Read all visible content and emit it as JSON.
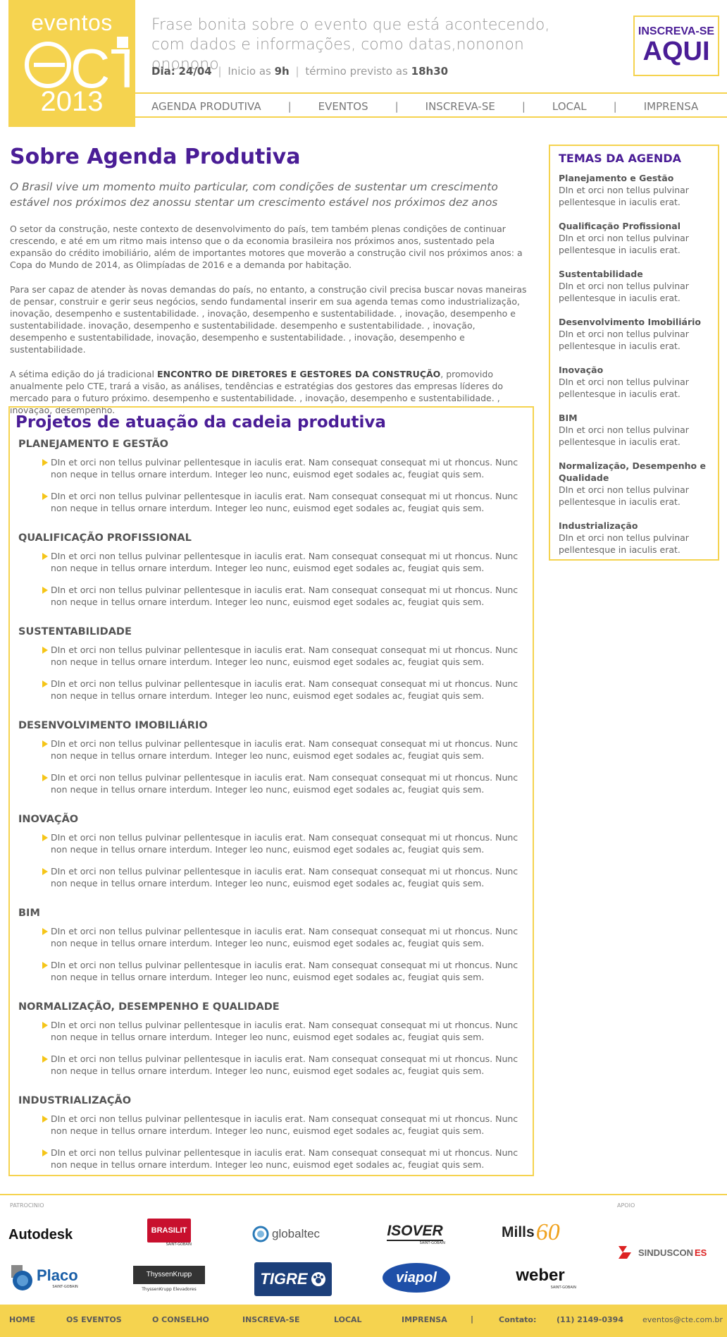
{
  "colors": {
    "accent_yellow": "#f5d34f",
    "brand_purple": "#4a1d96"
  },
  "logo": {
    "top_text": "eventos",
    "mid_text": "CTE",
    "year": "2013"
  },
  "header": {
    "tagline": "Frase bonita sobre o evento que está acontecendo, com dados e informações, como datas,nononon ononono",
    "date_label": "Dia:",
    "date_value": "24/04",
    "start_label": "Inicio as",
    "start_value": "9h",
    "end_label": "término previsto as",
    "end_value": "18h30",
    "cta_small": "INSCREVA-SE",
    "cta_big": "AQUI"
  },
  "nav": [
    "AGENDA PRODUTIVA",
    "EVENTOS",
    "INSCREVA-SE",
    "LOCAL",
    "IMPRENSA"
  ],
  "main": {
    "title": "Sobre Agenda Produtiva",
    "lead": "O Brasil vive um momento muito particular, com condições de sustentar um crescimento estável nos próximos dez anossu stentar um crescimento estável nos próximos dez anos",
    "para1": "O setor da construção, neste contexto de desenvolvimento do país, tem também plenas condições de continuar crescendo, e até em um ritmo mais intenso que o da economia brasileira nos próximos anos, sustentado pela expansão do crédito imobiliário, além de importantes motores que moverão a construção civil nos próximos anos: a Copa do Mundo de 2014, as Olimpíadas de 2016 e a demanda por habitação.",
    "para2": "Para ser capaz de atender às novas demandas do país, no entanto, a construção civil precisa buscar novas maneiras de pensar, construir e gerir seus negócios, sendo fundamental inserir em sua agenda temas como industrialização, inovação, desempenho e sustentabilidade. , inovação, desempenho e sustentabilidade. , inovação, desempenho e sustentabilidade. inovação, desempenho e sustentabilidade. desempenho e sustentabilidade. , inovação, desempenho e sustentabilidade, inovação, desempenho e sustentabilidade. , inovação, desempenho e sustentabilidade.",
    "para3_before": "A sétima edição do já tradicional ",
    "para3_bold": "ENCONTRO DE DIRETORES E GESTORES DA CONSTRUÇÃO",
    "para3_after": ", promovido anualmente pelo CTE, trará a visão, as análises, tendências e estratégias dos gestores das empresas líderes do mercado para o futuro próximo. desempenho e sustentabilidade. , inovação, desempenho e sustentabilidade. , inovação, desempenho."
  },
  "projects": {
    "title": "Projetos de atuação da cadeia produtiva",
    "bullet_text": "DIn et orci non tellus pulvinar pellentesque in iaculis erat. Nam consequat consequat mi ut rhoncus. Nunc non neque in tellus ornare interdum. Integer leo nunc, euismod eget sodales ac, feugiat quis sem.",
    "sections": [
      "PLANEJAMENTO E GESTÃO",
      "QUALIFICAÇÃO PROFISSIONAL",
      "SUSTENTABILIDADE",
      "DESENVOLVIMENTO IMOBILIÁRIO",
      "INOVAÇÃO",
      "BIM",
      "NORMALIZAÇÃO, DESEMPENHO E QUALIDADE",
      "INDUSTRIALIZAÇÃO"
    ]
  },
  "sidebar": {
    "title": "TEMAS DA AGENDA",
    "item_text": "DIn et orci non tellus pulvinar pellentesque in iaculis erat.",
    "items": [
      "Planejamento e Gestão",
      "Qualificação Profissional",
      "Sustentabilidade",
      "Desenvolvimento Imobiliário",
      "Inovação",
      "BIM",
      "Normalização, Desempenho e Qualidade",
      "Industrialização"
    ]
  },
  "sponsors": {
    "patrocinio_label": "PATROCINIO",
    "apoio_label": "APOIO",
    "autodesk": "Autodesk",
    "brasilit": "BRASILIT",
    "brasilit_sub": "SAINT-GOBAIN",
    "globaltec": "globaltec",
    "isover": "ISOVER",
    "isover_sub": "SAINT-GOBAIN",
    "mills": "Mills",
    "mills_num": "60",
    "placo": "Placo",
    "placo_sub": "SAINT-GOBAIN",
    "thyssen": "ThyssenKrupp",
    "thyssen_sub": "ThyssenKrupp Elevadores",
    "tigre": "TIGRE",
    "viapol": "viapol",
    "weber": "weber",
    "weber_sub": "SAINT-GOBAIN",
    "sinduscon": "SINDUSCON",
    "sinduscon_es": "ES"
  },
  "footer": {
    "links": [
      "HOME",
      "OS EVENTOS",
      "O CONSELHO",
      "INSCREVA-SE",
      "LOCAL",
      "IMPRENSA"
    ],
    "contact_label": "Contato:",
    "phone": "(11) 2149-0394",
    "email": "eventos@cte.com.br"
  }
}
